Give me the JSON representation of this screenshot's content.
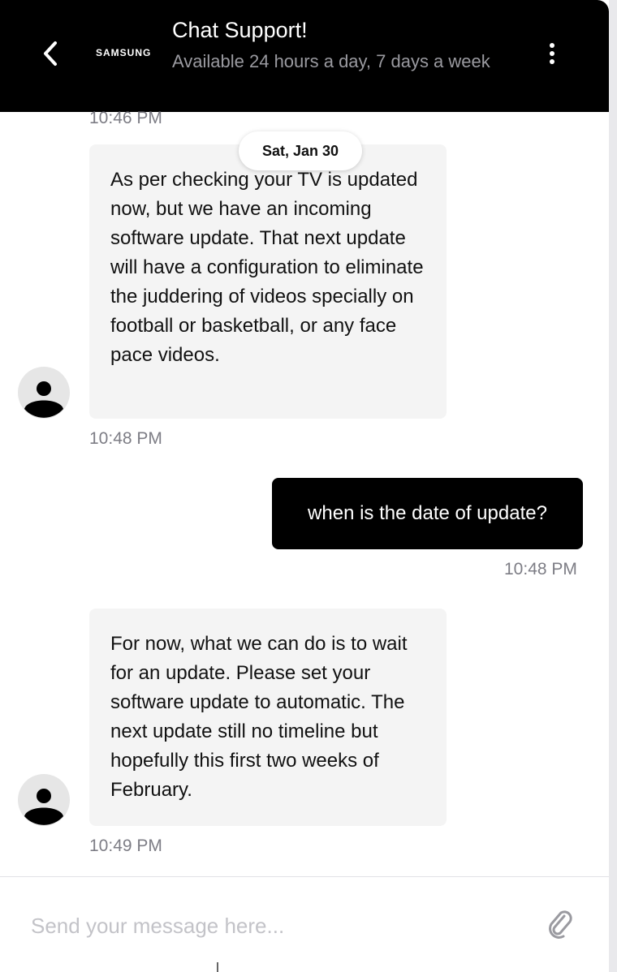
{
  "header": {
    "logo_text": "SAMSUNG",
    "title": "Chat Support!",
    "subtitle": "Available 24 hours a day, 7 days a week"
  },
  "date_divider": "Sat, Jan 30",
  "messages": [
    {
      "from": "agent",
      "time": "10:46 PM"
    },
    {
      "from": "agent",
      "text": "As per checking your TV is updated now, but we have an incoming software update. That next update will have a configuration to eliminate the juddering of videos specially on football or basketball, or any face pace videos.",
      "time": "10:48 PM"
    },
    {
      "from": "user",
      "text": "when is the date of update?",
      "time": "10:48 PM"
    },
    {
      "from": "agent",
      "text": "For now, what we can do is to wait for an update. Please set your software update to automatic. The next update still no timeline but hopefully this first two weeks of February.",
      "time": "10:49 PM"
    }
  ],
  "composer": {
    "placeholder": "Send your message here..."
  },
  "icons": {
    "back": "chevron-left-icon",
    "menu": "more-vertical-icon",
    "avatar": "user-avatar-icon",
    "attach": "paperclip-icon"
  },
  "colors": {
    "header_bg": "#000000",
    "agent_bubble": "#f4f4f4",
    "user_bubble": "#000000",
    "timestamp": "#7d7d85"
  }
}
